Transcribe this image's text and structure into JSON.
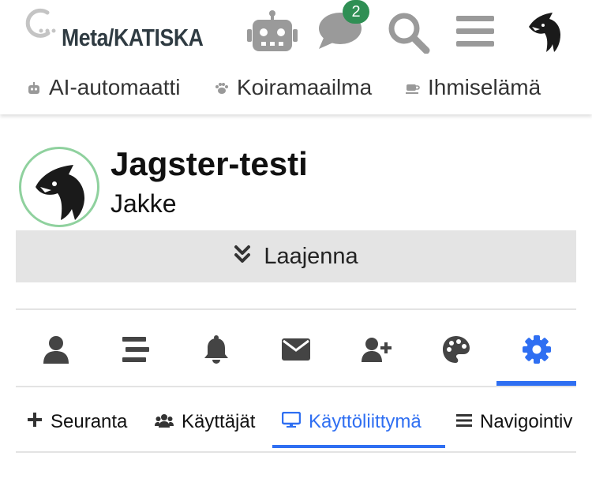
{
  "header": {
    "site_name": "Meta/KATISKA",
    "notification_count": "2",
    "icons": [
      "robot-icon",
      "chat-icon",
      "search-icon",
      "menu-icon",
      "user-avatar"
    ]
  },
  "categories": [
    {
      "label": "AI-automaatti",
      "icon": "robot-icon"
    },
    {
      "label": "Koiramaailma",
      "icon": "paw-icon"
    },
    {
      "label": "Ihmiselämä",
      "icon": "coffee-icon"
    }
  ],
  "profile": {
    "title": "Jagster-testi",
    "username": "Jakke",
    "expand_label": "Laajenna"
  },
  "profile_tabs": [
    {
      "icon": "user-icon",
      "active": false
    },
    {
      "icon": "stream-icon",
      "active": false
    },
    {
      "icon": "bell-icon",
      "active": false
    },
    {
      "icon": "envelope-icon",
      "active": false
    },
    {
      "icon": "user-plus-icon",
      "active": false
    },
    {
      "icon": "palette-icon",
      "active": false
    },
    {
      "icon": "gear-icon",
      "active": true
    }
  ],
  "settings_tabs": [
    {
      "label": "Seuranta",
      "icon": "plus-icon",
      "active": false
    },
    {
      "label": "Käyttäjät",
      "icon": "users-icon",
      "active": false
    },
    {
      "label": "Käyttöliittymä",
      "icon": "desktop-icon",
      "active": true
    },
    {
      "label": "Navigointiv",
      "icon": "bars-icon",
      "active": false
    }
  ],
  "colors": {
    "accent": "#2f6ff2",
    "badge": "#2f8f54",
    "avatar_ring": "#8fd19e",
    "icon_gray": "#9a9a9a",
    "dark_icon": "#444444"
  }
}
